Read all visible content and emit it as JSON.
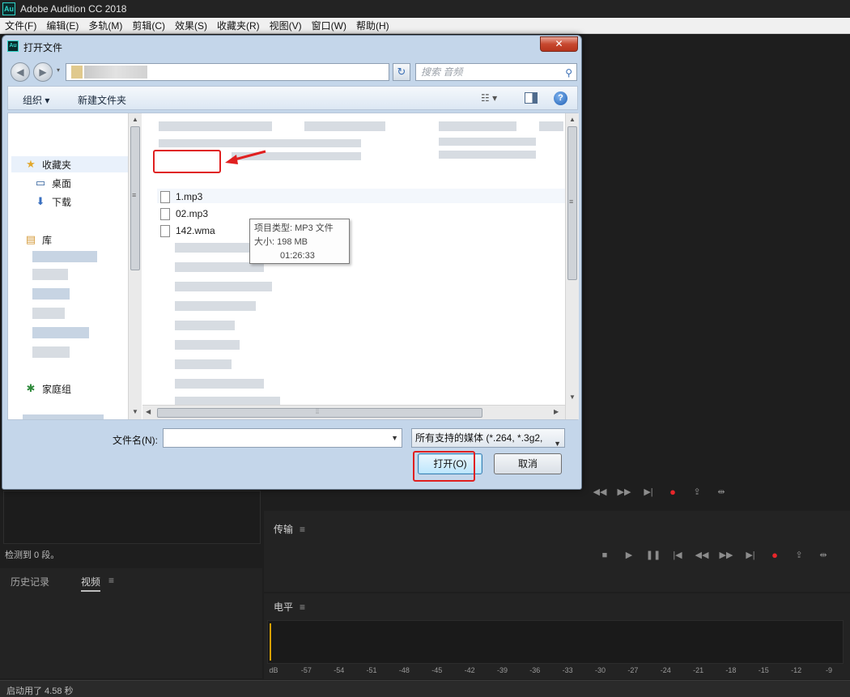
{
  "app": {
    "logo": "Au",
    "title": "Adobe Audition CC 2018"
  },
  "menu": [
    "文件(F)",
    "编辑(E)",
    "多轨(M)",
    "剪辑(C)",
    "效果(S)",
    "收藏夹(R)",
    "视图(V)",
    "窗口(W)",
    "帮助(H)"
  ],
  "panels": {
    "left_status": "检测到 0 段。",
    "history_tab": "历史记录",
    "video_tab": "视频",
    "transport_title": "传输",
    "level_title": "电平",
    "menu_glyph": "≡"
  },
  "level_scale": [
    "dB",
    "-57",
    "-54",
    "-51",
    "-48",
    "-45",
    "-42",
    "-39",
    "-36",
    "-33",
    "-30",
    "-27",
    "-24",
    "-21",
    "-18",
    "-15",
    "-12",
    "-9"
  ],
  "status_bar": "启动用了 4.58 秒",
  "dialog": {
    "title": "打开文件",
    "close_glyph": "✕",
    "search_placeholder": "搜索 音频",
    "toolbar": {
      "organize": "组织 ▾",
      "new_folder": "新建文件夹"
    },
    "nav": {
      "favorites": "收藏夹",
      "desktop": "桌面",
      "downloads": "下载",
      "libraries": "库",
      "homegroup": "家庭组"
    },
    "files": [
      "1.mp3",
      "02.mp3",
      "142.wma"
    ],
    "tooltip": {
      "type": "项目类型: MP3 文件",
      "size": "大小: 198 MB",
      "duration": "01:26:33"
    },
    "filename_label": "文件名(N):",
    "filename_value": "",
    "filter_value": "所有支持的媒体 (*.264, *.3g2,",
    "open_button": "打开(O)",
    "cancel_button": "取消"
  },
  "colors": {
    "annotation_red": "#e02020",
    "record_red": "#e8262a",
    "audition_teal": "#2fd3c7",
    "meter_yellow": "#d8a100"
  }
}
